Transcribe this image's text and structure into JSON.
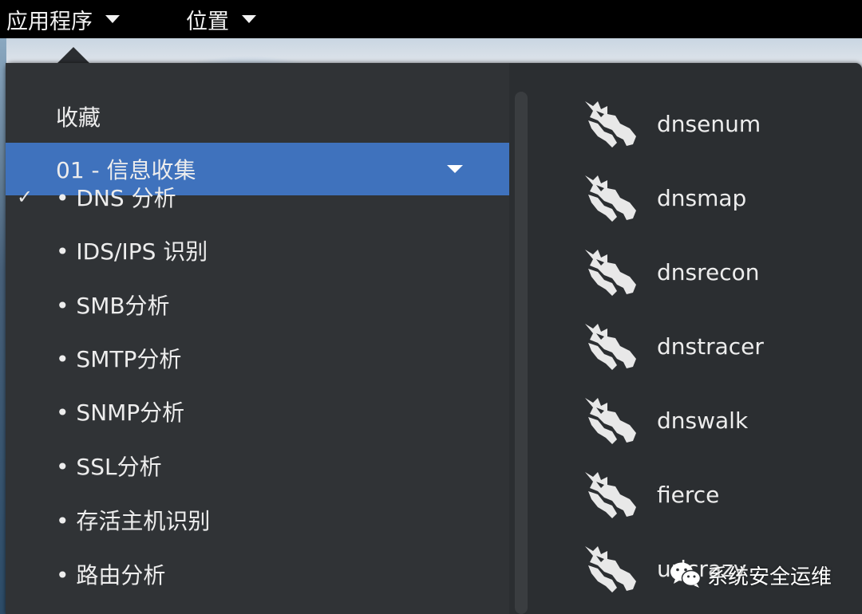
{
  "top_panel": {
    "applications_label": "应用程序",
    "places_label": "位置"
  },
  "menu": {
    "favorites_label": "收藏",
    "selected_category": {
      "label": "01 - 信息收集",
      "expanded": true
    },
    "subcategories": [
      {
        "label": "• DNS 分析",
        "checked": true
      },
      {
        "label": "• IDS/IPS 识别",
        "checked": false
      },
      {
        "label": "• SMB分析",
        "checked": false
      },
      {
        "label": "• SMTP分析",
        "checked": false
      },
      {
        "label": "• SNMP分析",
        "checked": false
      },
      {
        "label": "• SSL分析",
        "checked": false
      },
      {
        "label": "• 存活主机识别",
        "checked": false
      },
      {
        "label": "• 路由分析",
        "checked": false
      }
    ],
    "check_symbol": "✓",
    "applications": [
      {
        "label": "dnsenum",
        "icon": "kali-dragon-icon"
      },
      {
        "label": "dnsmap",
        "icon": "kali-dragon-icon"
      },
      {
        "label": "dnsrecon",
        "icon": "kali-dragon-icon"
      },
      {
        "label": "dnstracer",
        "icon": "kali-dragon-icon"
      },
      {
        "label": "dnswalk",
        "icon": "kali-dragon-icon"
      },
      {
        "label": "fierce",
        "icon": "kali-dragon-icon"
      },
      {
        "label": "urlcrazy",
        "icon": "kali-dragon-icon"
      }
    ]
  },
  "watermark": {
    "text": "系统安全运维",
    "icon": "wechat-icon"
  },
  "colors": {
    "panel": "#000000",
    "menu_bg": "#2b2e31",
    "selected": "#3f72bd",
    "text": "#ededed"
  }
}
